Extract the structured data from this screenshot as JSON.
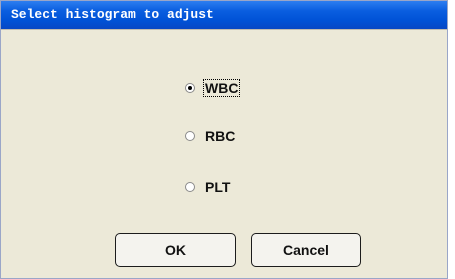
{
  "dialog": {
    "title": "Select histogram to adjust"
  },
  "options": [
    {
      "label": "WBC",
      "selected": true
    },
    {
      "label": "RBC",
      "selected": false
    },
    {
      "label": "PLT",
      "selected": false
    }
  ],
  "buttons": {
    "ok_label": "OK",
    "cancel_label": "Cancel"
  },
  "colors": {
    "title_bar": "#0052d6",
    "dialog_background": "#ece9d8"
  }
}
